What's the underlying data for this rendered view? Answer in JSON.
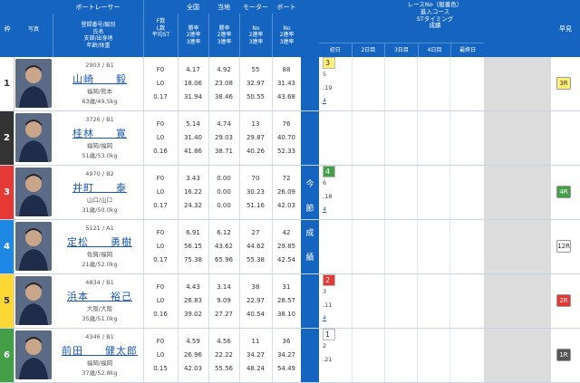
{
  "header": {
    "waku": "枠",
    "photo": "写真",
    "boat_racer": "ボートレーサー",
    "reg_line1": "登録番号/級別",
    "reg_line2": "氏名",
    "reg_line3": "支部/出身地",
    "reg_line4": "年齢/体重",
    "f_count": "F数",
    "l_count": "L数",
    "avg_st": "平均ST",
    "zenkoku": "全国",
    "touchi": "当地",
    "motor": "モーター",
    "boat": "ボート",
    "win_rate": "勝率",
    "two_rate": "2連率",
    "three_rate": "3連率",
    "no": "No",
    "two_rate_b": "2連率",
    "three_rate_b": "3連率",
    "race_no": "レースNo（艇番色）",
    "course": "進入コース",
    "st_timing": "STタイミング",
    "result": "成績",
    "days": [
      "初日",
      "2日目",
      "3日目",
      "4日目",
      "最終日"
    ],
    "hayami": "早見"
  },
  "konsetsu": [
    "今",
    "節",
    "成",
    "績"
  ],
  "racers": [
    {
      "waku": "1",
      "color": "#ffffff",
      "text": "#333",
      "reg": "2903 / B1",
      "name": "山崎　　毅",
      "branch": "福岡/熊本",
      "age": "63歳/49.5kg",
      "f": "F0",
      "l": "L0",
      "st": "0.17",
      "n1": "4.17",
      "n2": "18.06",
      "n3": "31.94",
      "t1": "4.92",
      "t2": "23.08",
      "t3": "38.46",
      "m1": "55",
      "m2": "32.97",
      "m3": "50.55",
      "b1": "88",
      "b2": "31.43",
      "b3": "43.68",
      "res": "3",
      "res_color": "#fff176",
      "res_text": "#333",
      "course": "5",
      "sttime": ".19",
      "place": "4",
      "hayami": "3R",
      "hayami_color": "#fff176",
      "hayami_text": "#333"
    },
    {
      "waku": "2",
      "color": "#333333",
      "text": "#fff",
      "reg": "3726 / B1",
      "name": "桂林　　寛",
      "branch": "福岡/福岡",
      "age": "51歳/53.0kg",
      "f": "F0",
      "l": "L0",
      "st": "0.16",
      "n1": "5.14",
      "n2": "31.40",
      "n3": "41.86",
      "t1": "4.74",
      "t2": "29.03",
      "t3": "38.71",
      "m1": "13",
      "m2": "29.87",
      "m3": "40.26",
      "b1": "76",
      "b2": "40.70",
      "b3": "52.33",
      "res": "",
      "res_color": "",
      "res_text": "",
      "course": "",
      "sttime": "",
      "place": "",
      "hayami": "",
      "hayami_color": "",
      "hayami_text": ""
    },
    {
      "waku": "3",
      "color": "#e53935",
      "text": "#fff",
      "reg": "4970 / B2",
      "name": "井町　　泰",
      "branch": "山口/山口",
      "age": "31歳/50.0kg",
      "f": "F0",
      "l": "L0",
      "st": "0.17",
      "n1": "3.43",
      "n2": "16.22",
      "n3": "24.32",
      "t1": "0.00",
      "t2": "0.00",
      "t3": "0.00",
      "m1": "70",
      "m2": "30.23",
      "m3": "51.16",
      "b1": "72",
      "b2": "26.09",
      "b3": "42.03",
      "res": "4",
      "res_color": "#43a047",
      "res_text": "#fff",
      "course": "6",
      "sttime": ".18",
      "place": "4",
      "hayami": "4R",
      "hayami_color": "#43a047",
      "hayami_text": "#fff"
    },
    {
      "waku": "4",
      "color": "#1e88e5",
      "text": "#fff",
      "reg": "5121 / A1",
      "name": "定松　　勇樹",
      "branch": "佐賀/福岡",
      "age": "21歳/52.0kg",
      "f": "F0",
      "l": "L0",
      "st": "0.17",
      "n1": "6.91",
      "n2": "56.15",
      "n3": "75.38",
      "t1": "6.12",
      "t2": "43.62",
      "t3": "65.96",
      "m1": "27",
      "m2": "44.62",
      "m3": "55.38",
      "b1": "42",
      "b2": "29.85",
      "b3": "42.54",
      "res": "",
      "res_color": "",
      "res_text": "",
      "course": "",
      "sttime": "",
      "place": "",
      "hayami": "12R",
      "hayami_color": "#ffffff",
      "hayami_text": "#333"
    },
    {
      "waku": "5",
      "color": "#fdd835",
      "text": "#333",
      "reg": "4834 / B1",
      "name": "浜本　　裕己",
      "branch": "大阪/大阪",
      "age": "35歳/51.0kg",
      "f": "F0",
      "l": "L0",
      "st": "0.16",
      "n1": "4.43",
      "n2": "26.83",
      "n3": "39.02",
      "t1": "3.14",
      "t2": "9.09",
      "t3": "27.27",
      "m1": "38",
      "m2": "22.97",
      "m3": "40.54",
      "b1": "31",
      "b2": "28.57",
      "b3": "38.10",
      "res": "2",
      "res_color": "#e53935",
      "res_text": "#fff",
      "course": "3",
      "sttime": ".11",
      "place": "4",
      "hayami": "2R",
      "hayami_color": "#e53935",
      "hayami_text": "#fff"
    },
    {
      "waku": "6",
      "color": "#43a047",
      "text": "#fff",
      "reg": "4346 / B1",
      "name": "前田　　健太郎",
      "branch": "福岡/福岡",
      "age": "37歳/52.8kg",
      "f": "F0",
      "l": "L0",
      "st": "0.15",
      "n1": "4.59",
      "n2": "26.96",
      "n3": "42.03",
      "t1": "4.56",
      "t2": "22.22",
      "t3": "55.56",
      "m1": "11",
      "m2": "34.27",
      "m3": "48.24",
      "b1": "36",
      "b2": "34.27",
      "b3": "54.49",
      "res": "1",
      "res_color": "#ffffff",
      "res_text": "#333",
      "course": "2",
      "sttime": ".21",
      "place": "",
      "hayami": "1R",
      "hayami_color": "#555555",
      "hayami_text": "#fff"
    }
  ]
}
